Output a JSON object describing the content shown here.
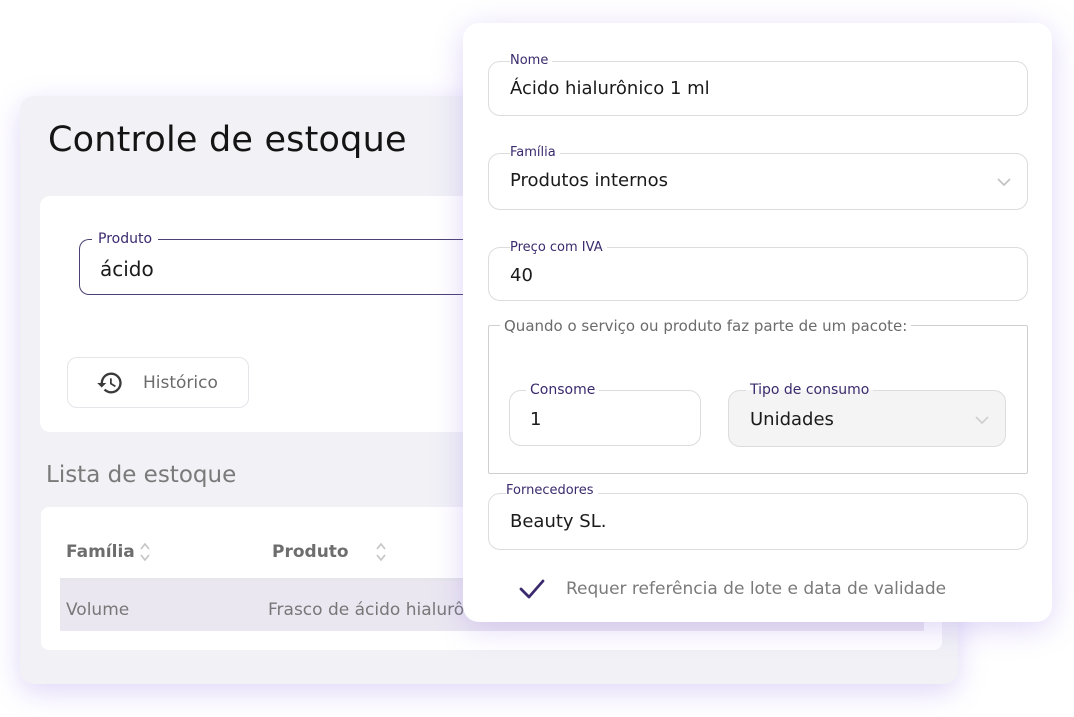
{
  "background": {
    "title": "Controle de estoque",
    "search": {
      "label": "Produto",
      "value": "ácido"
    },
    "history_button": {
      "label": "Histórico",
      "icon": "history-icon"
    },
    "list_title": "Lista de estoque",
    "table": {
      "columns": [
        "Família",
        "Produto"
      ],
      "rows": [
        {
          "familia": "Volume",
          "produto": "Frasco de ácido hialurô"
        }
      ]
    }
  },
  "modal": {
    "nome": {
      "label": "Nome",
      "value": "Ácido hialurônico 1 ml"
    },
    "familia": {
      "label": "Família",
      "value": "Produtos internos"
    },
    "preco": {
      "label": "Preço com IVA",
      "value": "40"
    },
    "pacote_group": {
      "legend": "Quando o serviço ou produto faz parte de um pacote:",
      "consome": {
        "label": "Consome",
        "value": "1"
      },
      "tipo": {
        "label": "Tipo de consumo",
        "value": "Unidades"
      }
    },
    "fornecedores": {
      "label": "Fornecedores",
      "value": "Beauty SL."
    },
    "lote_checkbox": {
      "label": "Requer referência de lote e data de validade",
      "checked": true
    }
  },
  "colors": {
    "accent": "#3b2a6d",
    "row_highlight": "#ebe7f1",
    "panel_bg": "#f1f1f6"
  }
}
